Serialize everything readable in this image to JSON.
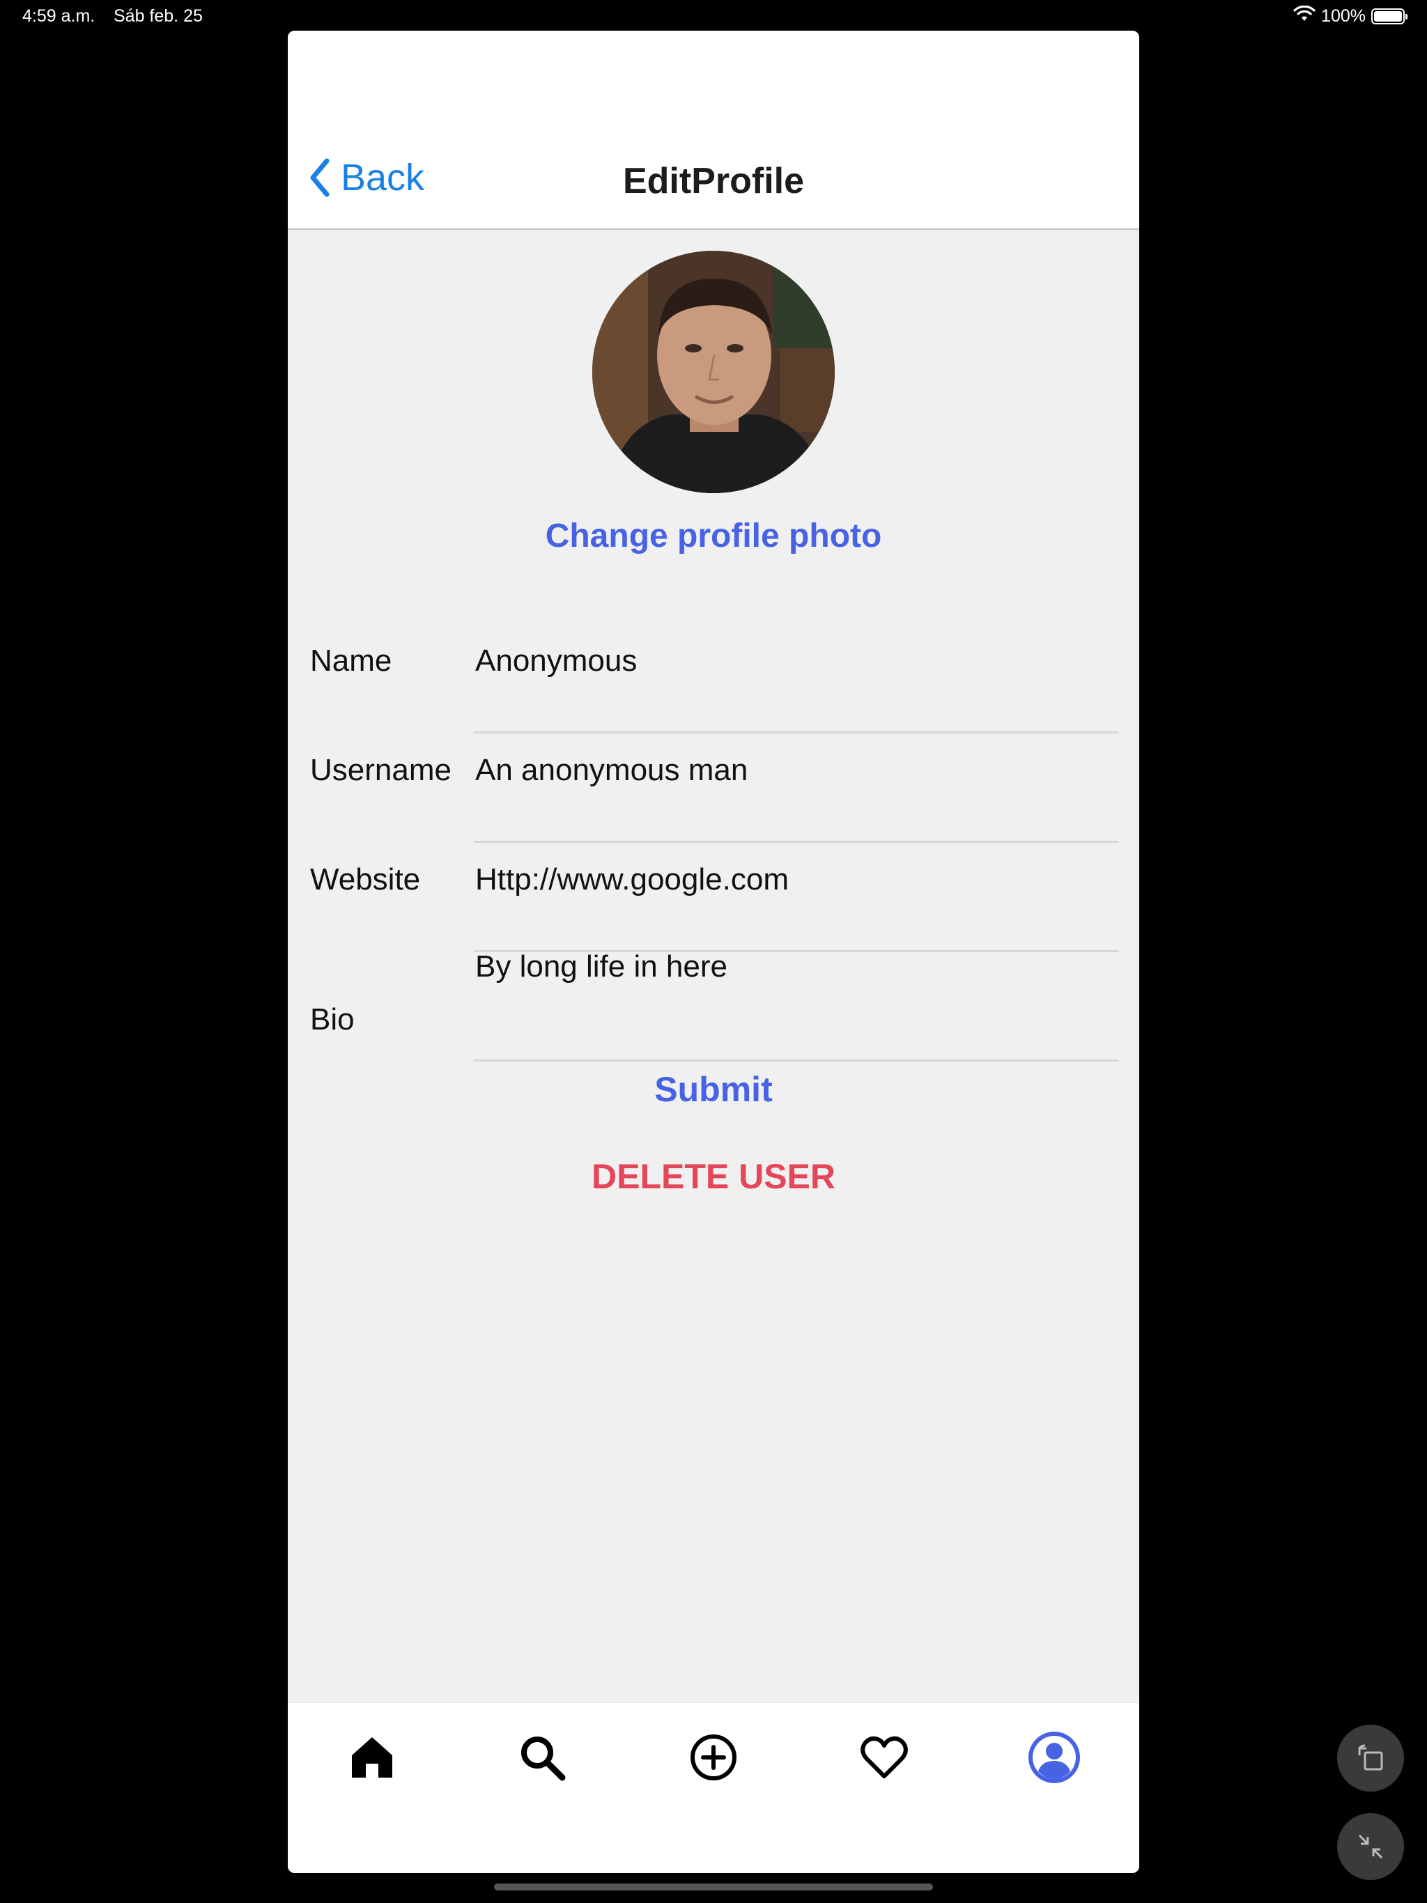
{
  "status_bar": {
    "time": "4:59 a.m.",
    "date": "Sáb feb. 25",
    "battery": "100%",
    "battery_level": 1.0,
    "icons": [
      "wifi-icon",
      "battery-icon"
    ]
  },
  "header": {
    "back_label": "Back",
    "title": "EditProfile"
  },
  "profile": {
    "change_photo_label": "Change profile photo"
  },
  "form": {
    "fields": [
      {
        "label": "Name",
        "value": "Anonymous"
      },
      {
        "label": "Username",
        "value": "An anonymous man"
      },
      {
        "label": "Website",
        "value": "Http://www.google.com"
      },
      {
        "label": "Bio",
        "value": "By long life in here"
      }
    ],
    "submit_label": "Submit",
    "delete_label": "DELETE USER"
  },
  "tab_bar": {
    "tabs": [
      {
        "name": "home-icon",
        "active": false
      },
      {
        "name": "search-icon",
        "active": false
      },
      {
        "name": "add-icon",
        "active": false
      },
      {
        "name": "heart-icon",
        "active": false
      },
      {
        "name": "profile-icon",
        "active": true
      }
    ]
  },
  "colors": {
    "accent_blue": "#4763e4",
    "back_blue": "#1a7fe6",
    "delete_red": "#e5475a",
    "content_bg": "#f0f0f0"
  }
}
